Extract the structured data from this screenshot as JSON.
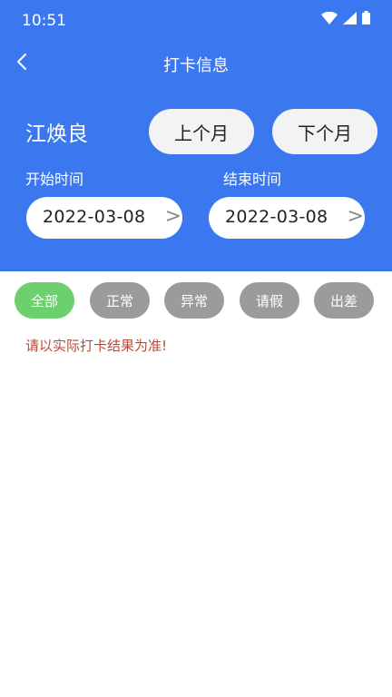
{
  "status_bar": {
    "time": "10:51",
    "icons": [
      "wifi-icon",
      "signal-icon",
      "battery-icon"
    ]
  },
  "titlebar": {
    "title": "打卡信息",
    "back_icon": "chevron-left-icon"
  },
  "user": {
    "name": "江焕良"
  },
  "month_nav": {
    "prev_label": "上个月",
    "next_label": "下个月"
  },
  "range": {
    "start_label": "开始时间",
    "start_value": "2022-03-08",
    "end_label": "结束时间",
    "end_value": "2022-03-08",
    "arrow": ">"
  },
  "filters": [
    {
      "label": "全部",
      "active": true
    },
    {
      "label": "正常",
      "active": false
    },
    {
      "label": "异常",
      "active": false
    },
    {
      "label": "请假",
      "active": false
    },
    {
      "label": "出差",
      "active": false
    }
  ],
  "notice": "请以实际打卡结果为准!",
  "colors": {
    "header": "#3b78f0",
    "chip_active": "#6cd06e",
    "chip_inactive": "#9b9b9b",
    "notice": "#b84a3a"
  }
}
